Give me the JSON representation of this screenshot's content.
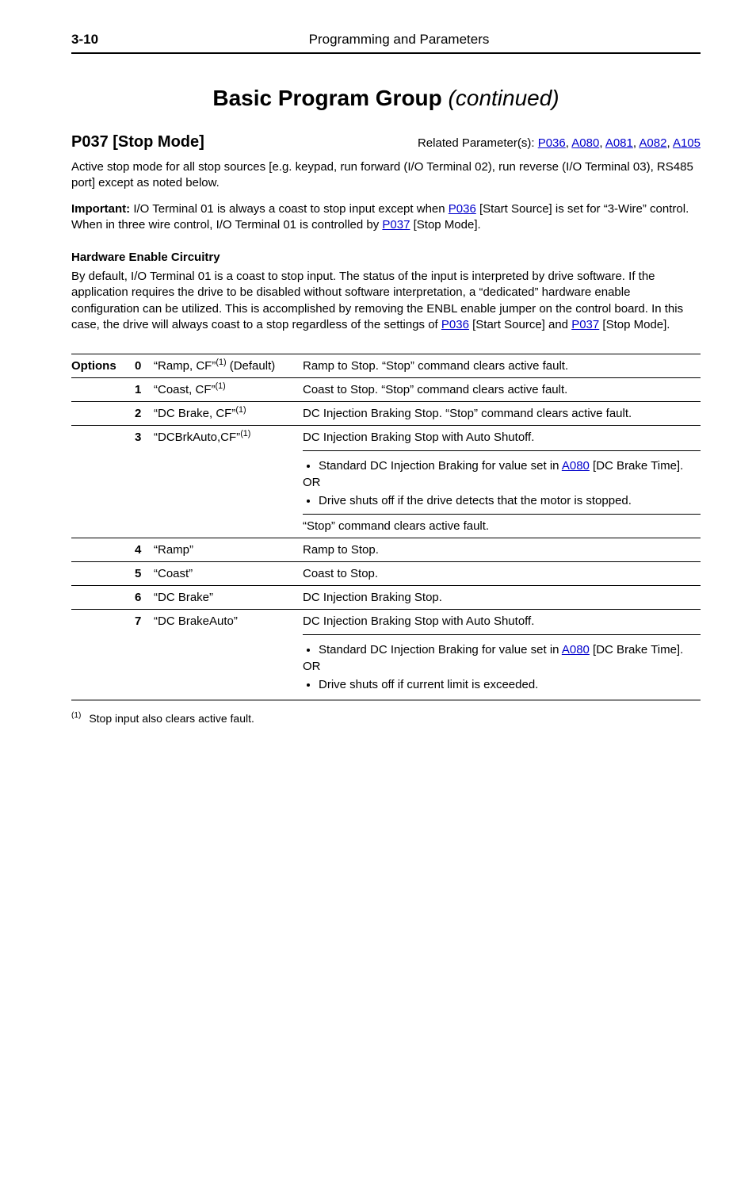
{
  "header": {
    "page_num": "3-10",
    "title": "Programming and Parameters"
  },
  "group": {
    "title": "Basic Program Group",
    "cont": "(continued)"
  },
  "param": {
    "name": "P037 [Stop Mode]",
    "related_label": "Related Parameter(s): ",
    "related_links": [
      "P036",
      "A080",
      "A081",
      "A082",
      "A105"
    ]
  },
  "para1_a": "Active stop mode for all stop sources [e.g. keypad, run forward (I/O Terminal 02), run reverse (I/O Terminal 03), RS485 port] except as noted below.",
  "para2_prefix": "Important:",
  "para2_a": " I/O Terminal 01 is always a coast to stop input except when ",
  "para2_link1": "P036",
  "para2_b": " [Start Source] is set for “3-Wire” control. When in three wire control, I/O Terminal 01 is controlled by ",
  "para2_link2": "P037",
  "para2_c": " [Stop Mode].",
  "hw_heading": "Hardware Enable Circuitry",
  "hw_a": "By default, I/O Terminal 01 is a coast to stop input. The status of the input is interpreted by drive software. If the application requires the drive to be disabled without software interpretation, a “dedicated” hardware enable configuration can be utilized. This is accomplished by removing the ENBL enable jumper on the control board. In this case, the drive will always coast to a stop regardless of the settings of ",
  "hw_link1": "P036",
  "hw_b": " [Start Source] and ",
  "hw_link2": "P037",
  "hw_c": " [Stop Mode].",
  "options_label": "Options",
  "rows": [
    {
      "num": "0",
      "name_a": "“Ramp, CF”",
      "name_sup": "(1)",
      "name_b": " (Default)",
      "desc": "Ramp to Stop. “Stop” command clears active fault."
    },
    {
      "num": "1",
      "name_a": "“Coast, CF”",
      "name_sup": "(1)",
      "name_b": "",
      "desc": "Coast to Stop. “Stop” command clears active fault."
    },
    {
      "num": "2",
      "name_a": "“DC Brake, CF”",
      "name_sup": "(1)",
      "name_b": "",
      "desc": "DC Injection Braking Stop. “Stop” command clears active fault."
    },
    {
      "num": "3",
      "name_a": "“DCBrkAuto,CF”",
      "name_sup": "(1)",
      "name_b": "",
      "desc_line1": "DC Injection Braking Stop with Auto Shutoff.",
      "bullet1_a": "Standard DC Injection Braking for value set in ",
      "bullet1_link": "A080",
      "bullet1_b": " [DC Brake Time].",
      "or": "OR",
      "bullet2": "Drive shuts off if the drive detects that the motor is stopped.",
      "desc_line2": "“Stop” command clears active fault."
    },
    {
      "num": "4",
      "name_a": "“Ramp”",
      "name_sup": "",
      "name_b": "",
      "desc": "Ramp to Stop."
    },
    {
      "num": "5",
      "name_a": "“Coast”",
      "name_sup": "",
      "name_b": "",
      "desc": "Coast to Stop."
    },
    {
      "num": "6",
      "name_a": "“DC Brake”",
      "name_sup": "",
      "name_b": "",
      "desc": "DC Injection Braking Stop."
    },
    {
      "num": "7",
      "name_a": "“DC BrakeAuto”",
      "name_sup": "",
      "name_b": "",
      "desc_line1": "DC Injection Braking Stop with Auto Shutoff.",
      "bullet1_a": "Standard DC Injection Braking for value set in ",
      "bullet1_link": "A080",
      "bullet1_b": " [DC Brake Time].",
      "or": "OR",
      "bullet2": "Drive shuts off if current limit is exceeded."
    }
  ],
  "footnote_sup": "(1)",
  "footnote_text": "Stop input also clears active fault."
}
